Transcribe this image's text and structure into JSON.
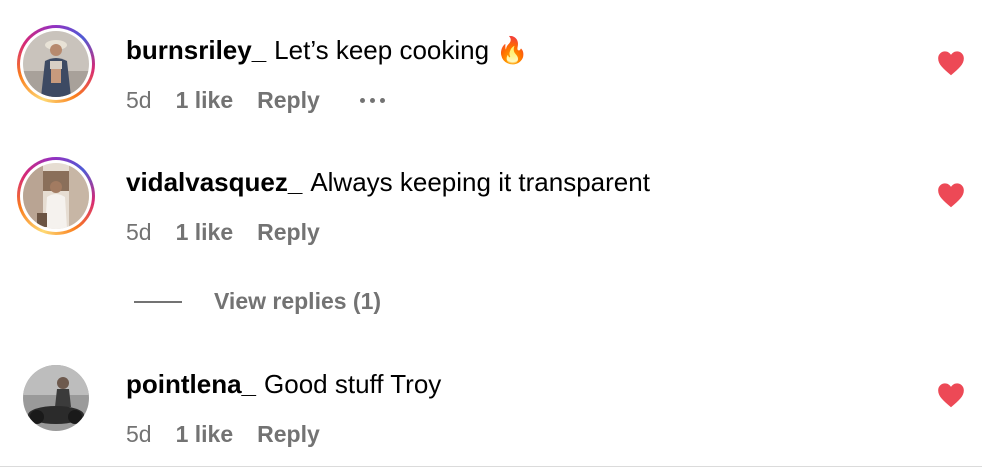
{
  "comments": [
    {
      "username": "burnsriley_",
      "text": "Let’s keep cooking 🔥",
      "time": "5d",
      "likes": "1 like",
      "reply": "Reply",
      "has_story_ring": true,
      "liked": true,
      "more_icon": "more-icon"
    },
    {
      "username": "vidalvasquez_",
      "text": "Always keeping it transparent",
      "time": "5d",
      "likes": "1 like",
      "reply": "Reply",
      "has_story_ring": true,
      "liked": true
    },
    {
      "username": "pointlena_",
      "text": "Good stuff Troy",
      "time": "5d",
      "likes": "1 like",
      "reply": "Reply",
      "has_story_ring": false,
      "liked": true
    }
  ],
  "view_replies": {
    "label": "View replies (1)"
  },
  "colors": {
    "heart": "#ed4956",
    "muted": "#737373",
    "text": "#000000"
  }
}
